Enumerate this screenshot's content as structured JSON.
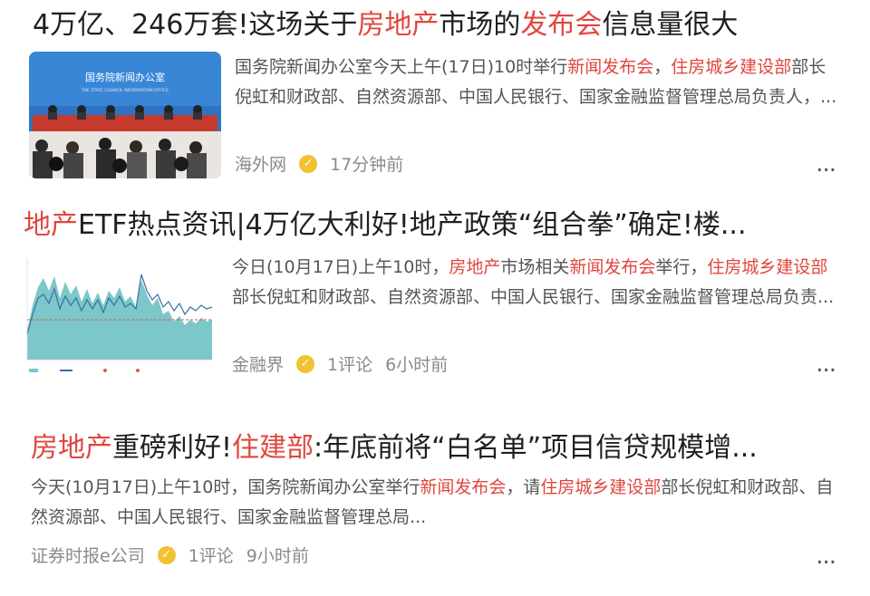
{
  "feed": [
    {
      "title": [
        {
          "text": "4万亿、246万套!这场关于",
          "hl": false
        },
        {
          "text": "房地产",
          "hl": true
        },
        {
          "text": "市场的",
          "hl": false
        },
        {
          "text": "发布会",
          "hl": true
        },
        {
          "text": "信息量很大",
          "hl": false
        }
      ],
      "thumbnail_caption": "国务院新闻办公室",
      "thumbnail_subcaption": "THE STATE COUNCIL INFORMATION OFFICE",
      "snippet": [
        {
          "text": "国务院新闻办公室今天上午(17日)10时举行",
          "hl": false
        },
        {
          "text": "新闻发布会",
          "hl": true
        },
        {
          "text": "，",
          "hl": false
        },
        {
          "text": "住房城乡建设部",
          "hl": true
        },
        {
          "text": "部长倪虹和财政部、自然资源部、中国人民银行、国家金融监督管理总局负责人，...",
          "hl": false
        }
      ],
      "source": "海外网",
      "comments": "",
      "time": "17分钟前",
      "more": "..."
    },
    {
      "title": [
        {
          "text": "地产",
          "hl": true
        },
        {
          "text": "ETF热点资讯|4万亿大利好!地产政策“组合拳”确定!楼...",
          "hl": false
        }
      ],
      "snippet": [
        {
          "text": "今日(10月17日)上午10时，",
          "hl": false
        },
        {
          "text": "房地产",
          "hl": true
        },
        {
          "text": "市场相关",
          "hl": false
        },
        {
          "text": "新闻发布会",
          "hl": true
        },
        {
          "text": "举行，",
          "hl": false
        },
        {
          "text": "住房城乡建设部",
          "hl": true
        },
        {
          "text": "部长倪虹和财政部、自然资源部、中国人民银行、国家金融监督管理总局负责...",
          "hl": false
        }
      ],
      "source": "金融界",
      "comments": "1评论",
      "time": "6小时前",
      "more": "..."
    },
    {
      "title": [
        {
          "text": "房地产",
          "hl": true
        },
        {
          "text": "重磅利好!",
          "hl": false
        },
        {
          "text": "住建部",
          "hl": true
        },
        {
          "text": ":年底前将“白名单”项目信贷规模增...",
          "hl": false
        }
      ],
      "snippet": [
        {
          "text": "今天(10月17日)上午10时，国务院新闻办公室举行",
          "hl": false
        },
        {
          "text": "新闻发布会",
          "hl": true
        },
        {
          "text": "，请",
          "hl": false
        },
        {
          "text": "住房城乡建设部",
          "hl": true
        },
        {
          "text": "部长倪虹和财政部、自然资源部、中国人民银行、国家金融监督管理总局...",
          "hl": false
        }
      ],
      "source": "证券时报e公司",
      "comments": "1评论",
      "time": "9小时前",
      "more": "..."
    }
  ],
  "colors": {
    "highlight": "#e0463f",
    "title": "#1f1f1f",
    "meta": "#8a8a8a",
    "badge": "#f1c232"
  }
}
